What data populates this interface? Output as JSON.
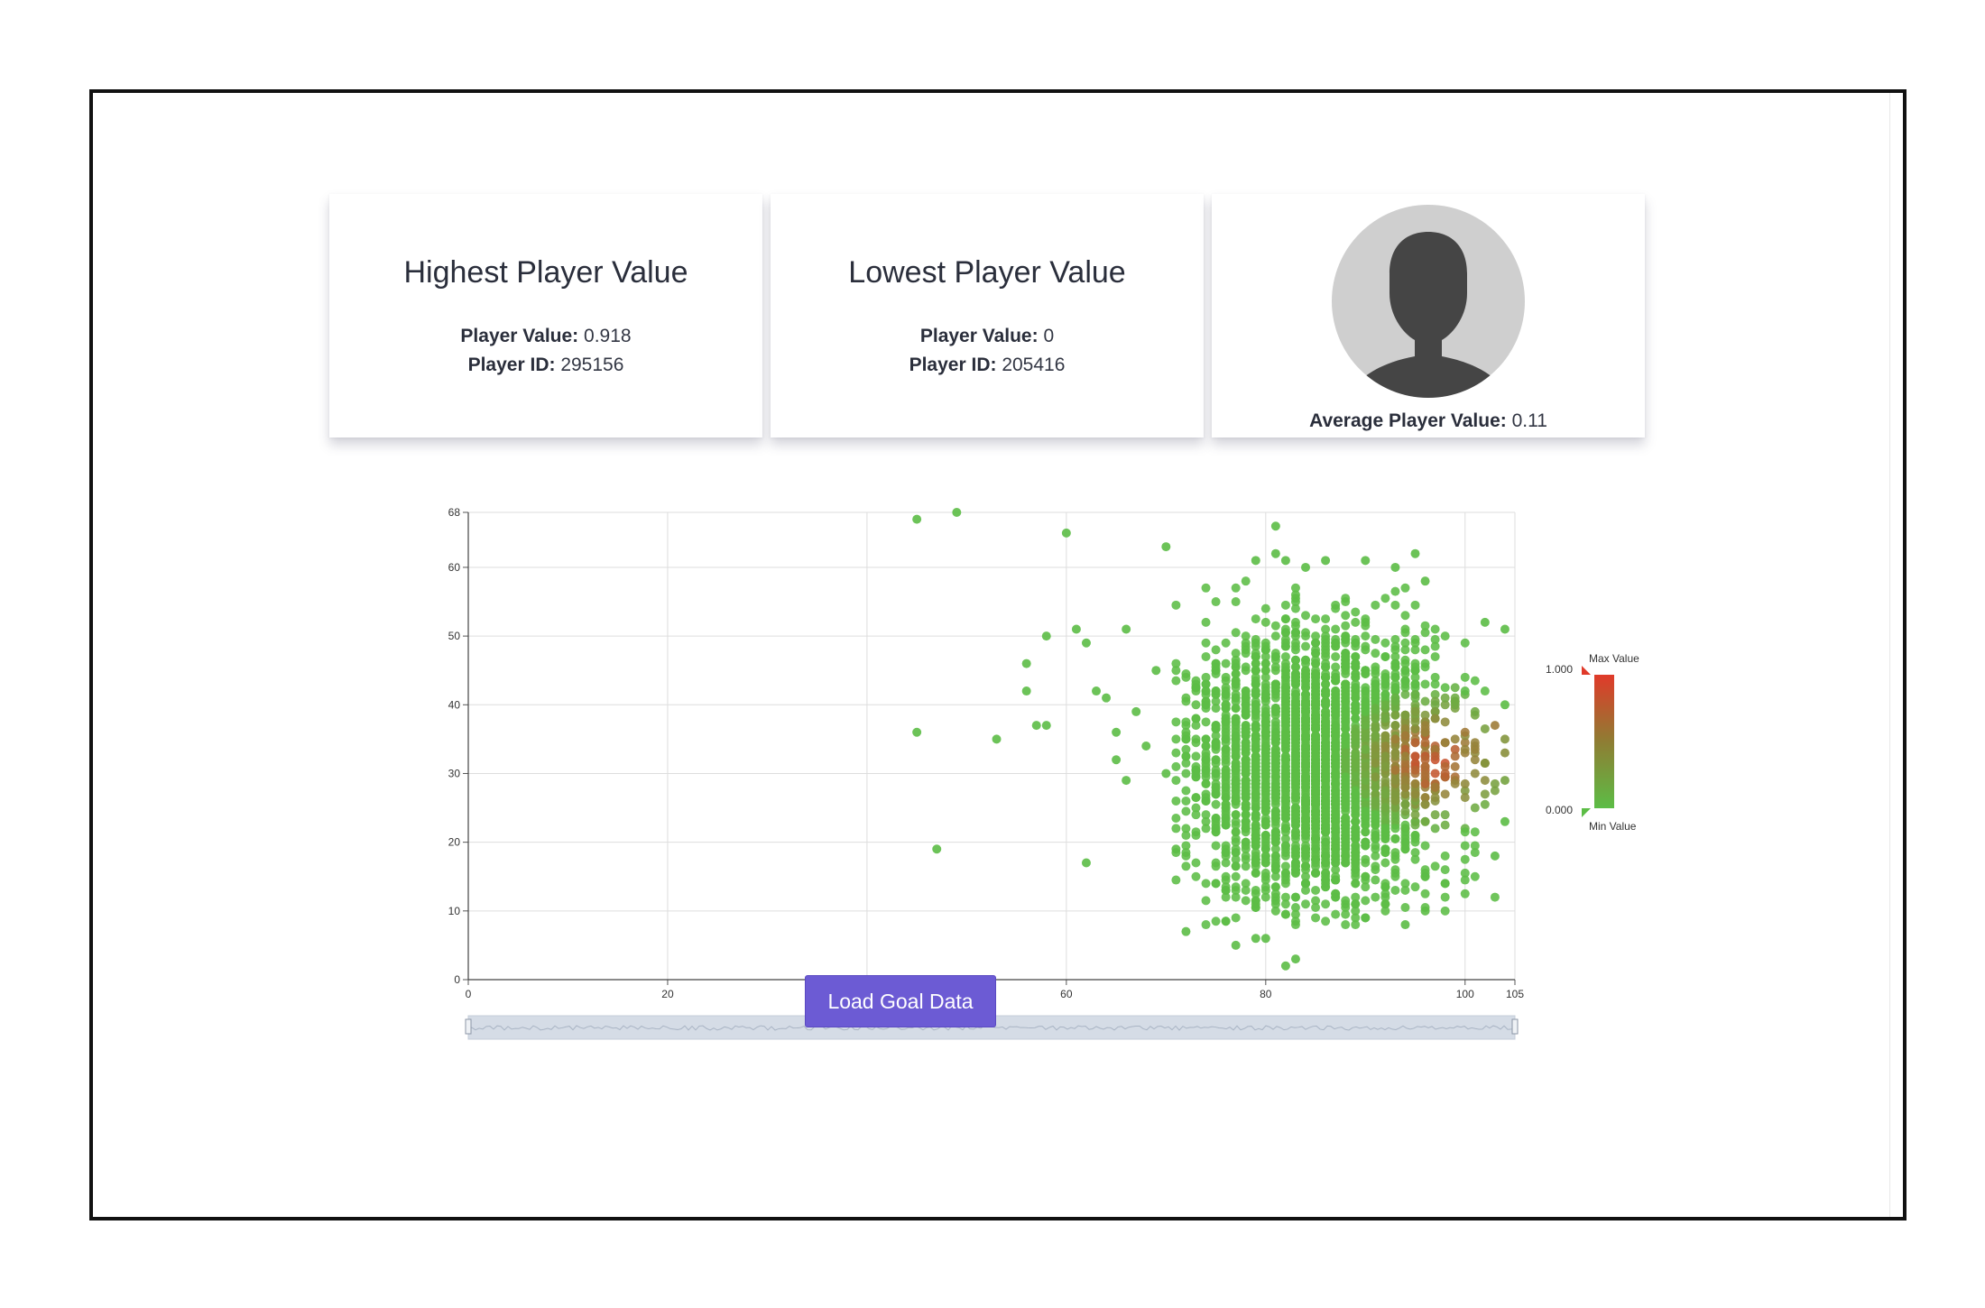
{
  "cards": {
    "highest": {
      "title": "Highest Player Value",
      "value_label": "Player Value:",
      "value": "0.918",
      "id_label": "Player ID:",
      "id": "295156"
    },
    "lowest": {
      "title": "Lowest Player Value",
      "value_label": "Player Value:",
      "value": "0",
      "id_label": "Player ID:",
      "id": "205416"
    },
    "average": {
      "label": "Average Player Value:",
      "value": "0.11"
    }
  },
  "button": {
    "label": "Load Goal Data"
  },
  "colors": {
    "accent": "#6c5bd4",
    "max_color": "#e03a2a",
    "min_color": "#5cbd46"
  },
  "icons": {
    "avatar": "person-silhouette-icon"
  },
  "legend": {
    "max_label": "Max Value",
    "min_label": "Min Value",
    "max_tick": "1.000",
    "min_tick": "0.000"
  },
  "chart_data": {
    "type": "scatter",
    "title": "",
    "xlabel": "",
    "ylabel": "",
    "xlim": [
      0,
      105
    ],
    "ylim": [
      0,
      68
    ],
    "x_ticks": [
      0,
      20,
      40,
      60,
      80,
      100,
      105
    ],
    "y_ticks": [
      0,
      10,
      20,
      30,
      40,
      50,
      60,
      68
    ],
    "grid": true,
    "color_scale": {
      "min": 0.0,
      "max": 1.0,
      "min_color": "#5cbd46",
      "max_color": "#e03a2a"
    },
    "has_range_slider": true,
    "points": [
      {
        "x": 45,
        "y": 67,
        "v": 0.0
      },
      {
        "x": 49,
        "y": 68,
        "v": 0.0
      },
      {
        "x": 60,
        "y": 65,
        "v": 0.0
      },
      {
        "x": 70,
        "y": 63,
        "v": 0.0
      },
      {
        "x": 45,
        "y": 36,
        "v": 0.0
      },
      {
        "x": 47,
        "y": 19,
        "v": 0.0
      },
      {
        "x": 51,
        "y": 0,
        "v": 0.0
      },
      {
        "x": 53,
        "y": 35,
        "v": 0.0
      },
      {
        "x": 56,
        "y": 46,
        "v": 0.0
      },
      {
        "x": 56,
        "y": 42,
        "v": 0.0
      },
      {
        "x": 57,
        "y": 37,
        "v": 0.0
      },
      {
        "x": 58,
        "y": 37,
        "v": 0.0
      },
      {
        "x": 58,
        "y": 50,
        "v": 0.0
      },
      {
        "x": 61,
        "y": 51,
        "v": 0.0
      },
      {
        "x": 62,
        "y": 49,
        "v": 0.0
      },
      {
        "x": 62,
        "y": 17,
        "v": 0.0
      },
      {
        "x": 63,
        "y": 42,
        "v": 0.0
      },
      {
        "x": 64,
        "y": 41,
        "v": 0.0
      },
      {
        "x": 65,
        "y": 36,
        "v": 0.0
      },
      {
        "x": 66,
        "y": 51,
        "v": 0.0
      },
      {
        "x": 66,
        "y": 29,
        "v": 0.0
      },
      {
        "x": 65,
        "y": 32,
        "v": 0.0
      },
      {
        "x": 67,
        "y": 39,
        "v": 0.0
      },
      {
        "x": 68,
        "y": 34,
        "v": 0.0
      },
      {
        "x": 69,
        "y": 45,
        "v": 0.0
      },
      {
        "x": 70,
        "y": 30,
        "v": 0.0
      },
      {
        "x": 71,
        "y": 19,
        "v": 0.0
      },
      {
        "x": 72,
        "y": 7,
        "v": 0.0
      },
      {
        "x": 77,
        "y": 5,
        "v": 0.0
      },
      {
        "x": 79,
        "y": 6,
        "v": 0.0
      },
      {
        "x": 80,
        "y": 6,
        "v": 0.0
      },
      {
        "x": 82,
        "y": 2,
        "v": 0.0
      },
      {
        "x": 83,
        "y": 3,
        "v": 0.0
      },
      {
        "x": 81,
        "y": 66,
        "v": 0.0
      },
      {
        "x": 81,
        "y": 62,
        "v": 0.0
      },
      {
        "x": 79,
        "y": 61,
        "v": 0.0
      },
      {
        "x": 82,
        "y": 61,
        "v": 0.0
      },
      {
        "x": 84,
        "y": 60,
        "v": 0.0
      },
      {
        "x": 86,
        "y": 61,
        "v": 0.0
      },
      {
        "x": 90,
        "y": 61,
        "v": 0.0
      },
      {
        "x": 93,
        "y": 60,
        "v": 0.0
      },
      {
        "x": 95,
        "y": 62,
        "v": 0.0
      },
      {
        "x": 96,
        "y": 58,
        "v": 0.0
      },
      {
        "x": 102,
        "y": 52,
        "v": 0.0
      },
      {
        "x": 104,
        "y": 51,
        "v": 0.0
      },
      {
        "x": 104,
        "y": 40,
        "v": 0.0
      },
      {
        "x": 104,
        "y": 23,
        "v": 0.0
      },
      {
        "x": 103,
        "y": 18,
        "v": 0.0
      },
      {
        "x": 96,
        "y": 10,
        "v": 0.0
      },
      {
        "x": 94,
        "y": 8,
        "v": 0.0
      },
      {
        "x": 90,
        "y": 9,
        "v": 0.0
      },
      {
        "x": 88,
        "y": 11,
        "v": 0.0
      },
      {
        "x": 104,
        "y": 35,
        "v": 0.3
      },
      {
        "x": 104,
        "y": 33,
        "v": 0.35
      },
      {
        "x": 104,
        "y": 29,
        "v": 0.2
      },
      {
        "x": 103,
        "y": 37,
        "v": 0.5
      }
    ],
    "clusters": [
      {
        "x_range": [
          71,
          104
        ],
        "y_range": [
          8,
          58
        ],
        "x_mean": 85,
        "y_mean": 31,
        "x_sd": 6.5,
        "y_sd": 9.5,
        "count": 3200,
        "value_center": [
          97,
          32
        ],
        "value_spread": [
          6,
          7
        ],
        "value_peak": 0.918
      }
    ]
  }
}
